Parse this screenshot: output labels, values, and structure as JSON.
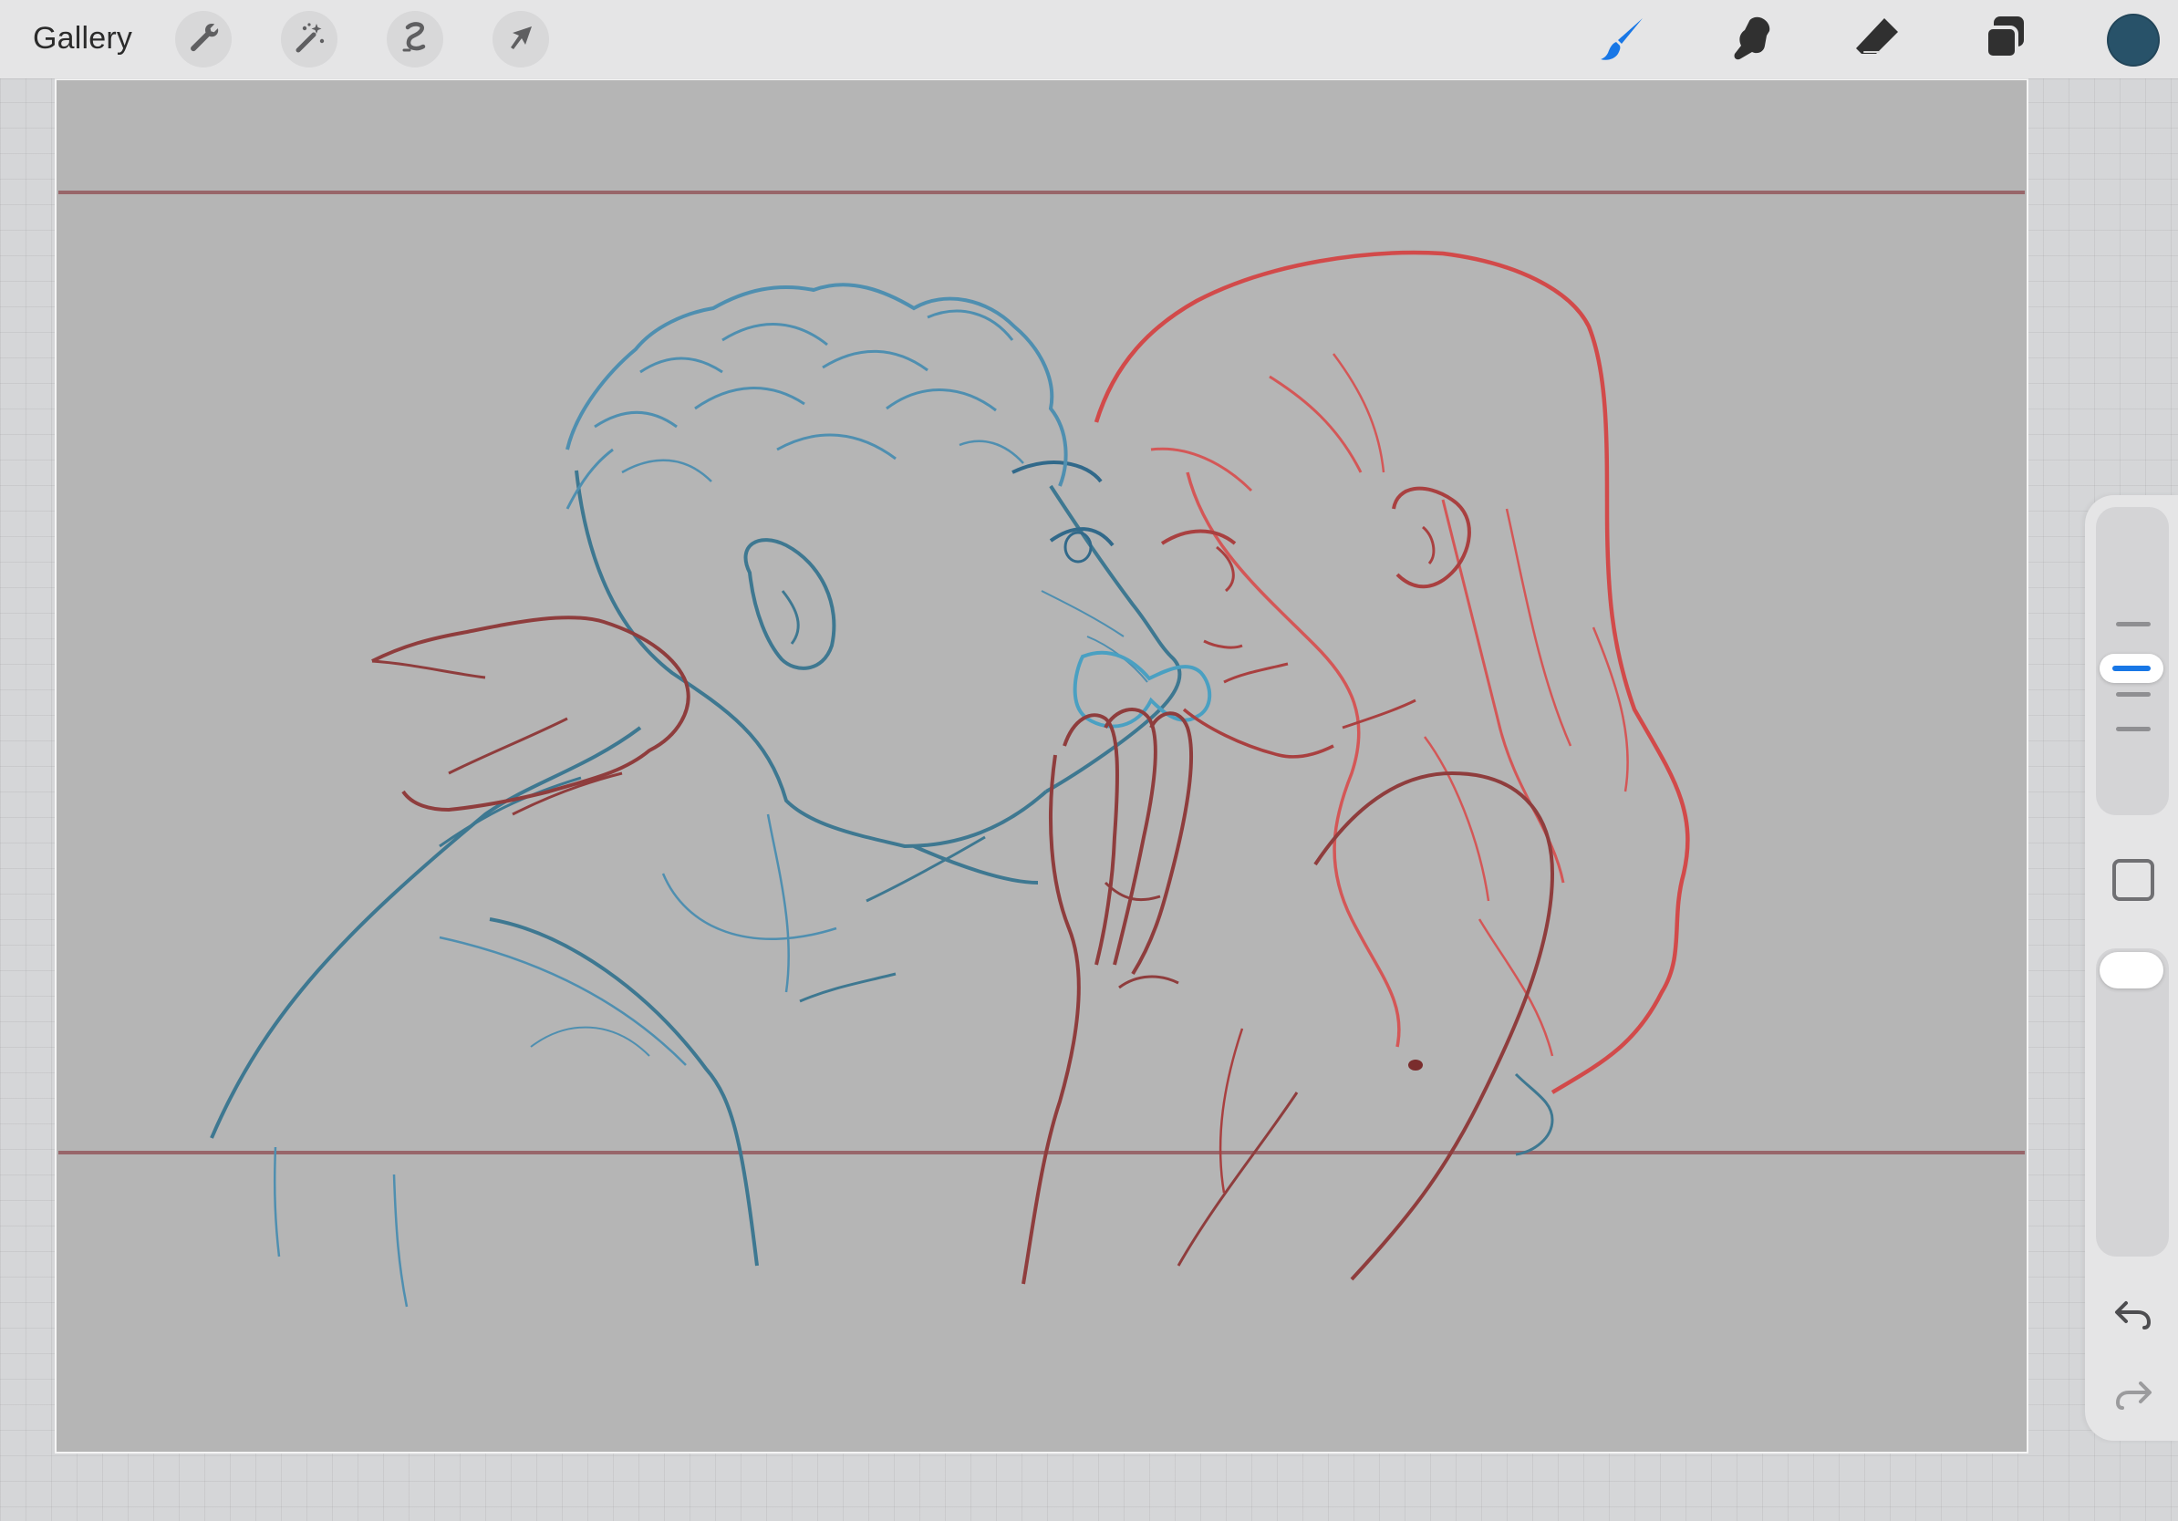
{
  "topbar": {
    "gallery_label": "Gallery",
    "left_tools": [
      {
        "name": "actions",
        "icon": "wrench-icon"
      },
      {
        "name": "adjustments",
        "icon": "magic-wand-icon"
      },
      {
        "name": "selection",
        "icon": "selection-s-icon"
      },
      {
        "name": "transform",
        "icon": "arrow-cursor-icon"
      }
    ],
    "right_tools": [
      {
        "name": "brush",
        "icon": "brush-icon",
        "active": true,
        "color": "#1877e6"
      },
      {
        "name": "smudge",
        "icon": "smudge-finger-icon",
        "active": false
      },
      {
        "name": "eraser",
        "icon": "eraser-icon",
        "active": false
      },
      {
        "name": "layers",
        "icon": "layers-icon",
        "active": false
      }
    ],
    "current_color": "#285269"
  },
  "canvas": {
    "background": "#b5b5b5",
    "guide_color": "#9b4c52",
    "sketch_colors": {
      "man": "#4f8fb0",
      "woman": "#d45757",
      "hands": "#8f4a4a"
    }
  },
  "sidebar": {
    "brush_size_level": 0.38,
    "opacity_level": 1.0,
    "undo_icon": "undo-icon",
    "redo_icon": "redo-icon",
    "modify_icon": "square-icon"
  }
}
